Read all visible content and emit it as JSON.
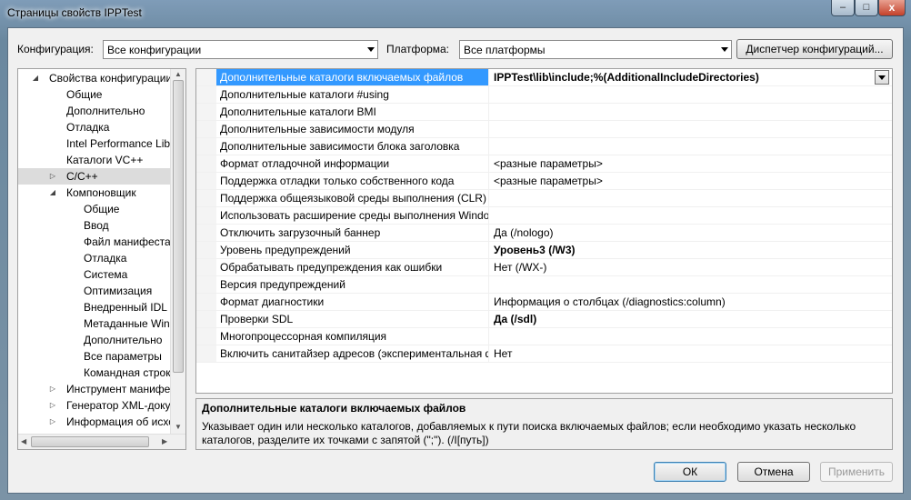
{
  "window": {
    "title": "Страницы свойств IPPTest",
    "minimize": "–",
    "maximize": "□",
    "close": "x"
  },
  "toolbar": {
    "config_label": "Конфигурация:",
    "config_value": "Все конфигурации",
    "platform_label": "Платформа:",
    "platform_value": "Все платформы",
    "config_manager_button": "Диспетчер конфигураций..."
  },
  "tree": {
    "items": [
      {
        "label": "Свойства конфигурации",
        "twisty": "◢"
      },
      {
        "label": "Общие",
        "twisty": ""
      },
      {
        "label": "Дополнительно",
        "twisty": ""
      },
      {
        "label": "Отладка",
        "twisty": ""
      },
      {
        "label": "Intel Performance Libra",
        "twisty": ""
      },
      {
        "label": "Каталоги VC++",
        "twisty": ""
      },
      {
        "label": "C/C++",
        "twisty": "▷"
      },
      {
        "label": "Компоновщик",
        "twisty": "◢"
      },
      {
        "label": "Общие",
        "twisty": ""
      },
      {
        "label": "Ввод",
        "twisty": ""
      },
      {
        "label": "Файл манифеста",
        "twisty": ""
      },
      {
        "label": "Отладка",
        "twisty": ""
      },
      {
        "label": "Система",
        "twisty": ""
      },
      {
        "label": "Оптимизация",
        "twisty": ""
      },
      {
        "label": "Внедренный IDL",
        "twisty": ""
      },
      {
        "label": "Метаданные Windo",
        "twisty": ""
      },
      {
        "label": "Дополнительно",
        "twisty": ""
      },
      {
        "label": "Все параметры",
        "twisty": ""
      },
      {
        "label": "Командная строка",
        "twisty": ""
      },
      {
        "label": "Инструмент манифест",
        "twisty": "▷"
      },
      {
        "label": "Генератор XML-докум",
        "twisty": "▷"
      },
      {
        "label": "Информация об исход",
        "twisty": "▷"
      }
    ]
  },
  "grid": {
    "rows": [
      {
        "name": "Дополнительные каталоги включаемых файлов",
        "value": "IPPTest\\lib\\include;%(AdditionalIncludeDirectories)"
      },
      {
        "name": "Дополнительные каталоги #using",
        "value": ""
      },
      {
        "name": "Дополнительные каталоги BMI",
        "value": ""
      },
      {
        "name": "Дополнительные зависимости модуля",
        "value": ""
      },
      {
        "name": "Дополнительные зависимости блока заголовка",
        "value": ""
      },
      {
        "name": "Формат отладочной информации",
        "value": "<разные параметры>"
      },
      {
        "name": "Поддержка отладки только собственного кода",
        "value": "<разные параметры>"
      },
      {
        "name": "Поддержка общеязыковой среды выполнения (CLR)",
        "value": ""
      },
      {
        "name": "Использовать расширение среды выполнения Windo",
        "value": ""
      },
      {
        "name": "Отключить загрузочный баннер",
        "value": "Да (/nologo)"
      },
      {
        "name": "Уровень предупреждений",
        "value": "Уровень3 (/W3)"
      },
      {
        "name": "Обрабатывать предупреждения как ошибки",
        "value": "Нет (/WX-)"
      },
      {
        "name": "Версия предупреждений",
        "value": ""
      },
      {
        "name": "Формат диагностики",
        "value": "Информация о столбцах (/diagnostics:column)"
      },
      {
        "name": "Проверки SDL",
        "value": "Да (/sdl)"
      },
      {
        "name": "Многопроцессорная компиляция",
        "value": ""
      },
      {
        "name": "Включить санитайзер адресов (экспериментальная ф",
        "value": "Нет"
      }
    ]
  },
  "description": {
    "title": "Дополнительные каталоги включаемых файлов",
    "text": "Указывает один или несколько каталогов, добавляемых к пути поиска включаемых файлов; если необходимо указать несколько каталогов, разделите их точками с запятой (\";\").     (/I[путь])"
  },
  "buttons": {
    "ok": "ОК",
    "cancel": "Отмена",
    "apply": "Применить"
  },
  "colors": {
    "selection": "#3399ff",
    "titlebar": "#6a889f"
  }
}
